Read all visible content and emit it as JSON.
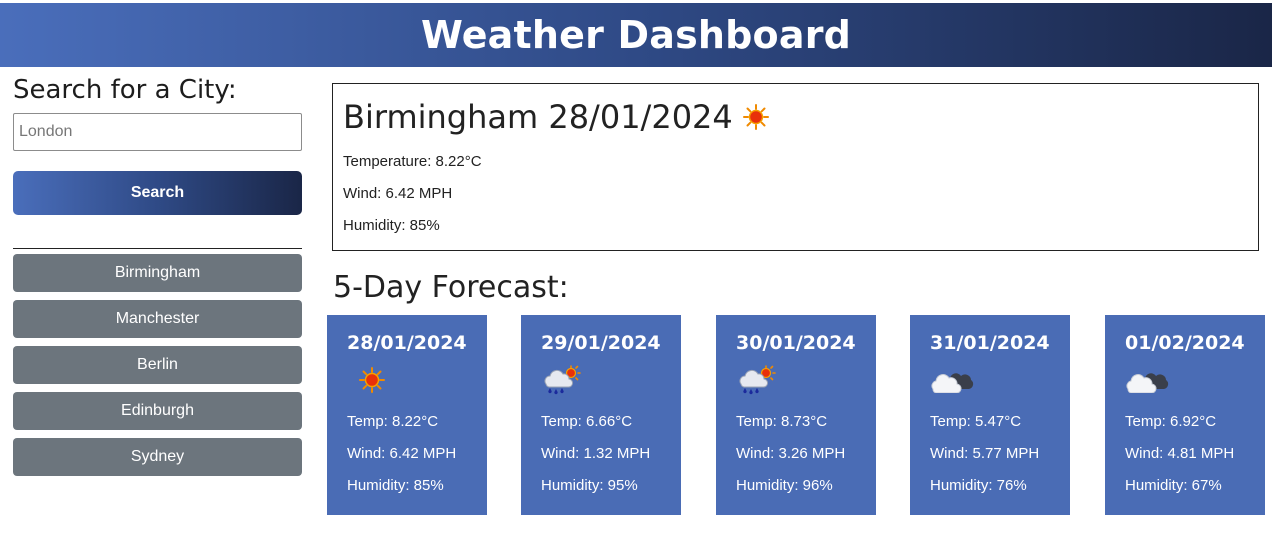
{
  "header": {
    "title": "Weather Dashboard"
  },
  "sidebar": {
    "search_title": "Search for a City:",
    "search_placeholder": "London",
    "search_button": "Search",
    "history": [
      "Birmingham",
      "Manchester",
      "Berlin",
      "Edinburgh",
      "Sydney"
    ]
  },
  "current": {
    "title": "Birmingham 28/01/2024",
    "icon": "sun-icon",
    "temperature": "Temperature: 8.22°C",
    "wind": "Wind: 6.42 MPH",
    "humidity": "Humidity: 85%"
  },
  "forecast": {
    "title": "5-Day Forecast:",
    "days": [
      {
        "date": "28/01/2024",
        "icon": "sun-icon",
        "temp": "Temp: 8.22°C",
        "wind": "Wind: 6.42 MPH",
        "humidity": "Humidity: 85%"
      },
      {
        "date": "29/01/2024",
        "icon": "rain-sun-icon",
        "temp": "Temp: 6.66°C",
        "wind": "Wind: 1.32 MPH",
        "humidity": "Humidity: 95%"
      },
      {
        "date": "30/01/2024",
        "icon": "rain-sun-icon",
        "temp": "Temp: 8.73°C",
        "wind": "Wind: 3.26 MPH",
        "humidity": "Humidity: 96%"
      },
      {
        "date": "31/01/2024",
        "icon": "cloud-icon",
        "temp": "Temp: 5.47°C",
        "wind": "Wind: 5.77 MPH",
        "humidity": "Humidity: 76%"
      },
      {
        "date": "01/02/2024",
        "icon": "cloud-icon",
        "temp": "Temp: 6.92°C",
        "wind": "Wind: 4.81 MPH",
        "humidity": "Humidity: 67%"
      }
    ]
  },
  "colors": {
    "header_gradient_start": "#4a6ebb",
    "header_gradient_end": "#1a2647",
    "card_bg": "#4a6cb5",
    "history_button_bg": "#6c757d"
  }
}
